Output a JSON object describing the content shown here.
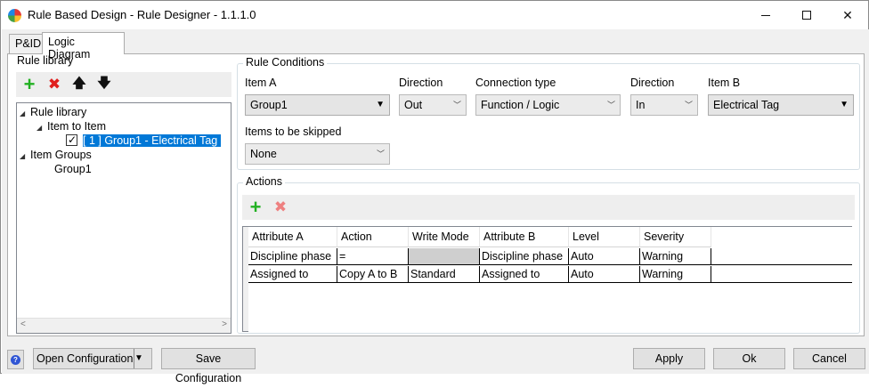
{
  "window": {
    "title": "Rule Based Design - Rule Designer - 1.1.1.0",
    "minimize_glyph": "—",
    "close_glyph": "✕"
  },
  "tabs": [
    {
      "label": "P&ID"
    },
    {
      "label": "Logic Diagram"
    }
  ],
  "rule_library": {
    "title": "Rule library",
    "tree": {
      "root": "Rule library",
      "item_to_item": "Item to Item",
      "rule_entry": "[ 1 ]   Group1 - Electrical Tag",
      "item_groups": "Item Groups",
      "group1": "Group1"
    }
  },
  "rule_conditions": {
    "title": "Rule Conditions",
    "item_a": {
      "label": "Item A",
      "value": "Group1"
    },
    "direction_a": {
      "label": "Direction",
      "value": "Out"
    },
    "connection_type": {
      "label": "Connection type",
      "value": "Function / Logic"
    },
    "direction_b": {
      "label": "Direction",
      "value": "In"
    },
    "item_b": {
      "label": "Item B",
      "value": "Electrical Tag"
    },
    "items_skipped": {
      "label": "Items to be skipped",
      "value": "None"
    }
  },
  "actions": {
    "title": "Actions",
    "columns": [
      "Attribute A",
      "Action",
      "Write Mode",
      "Attribute B",
      "Level",
      "Severity"
    ],
    "rows": [
      [
        "Discipline phase",
        "=",
        "",
        "Discipline phase",
        "Auto",
        "Warning"
      ],
      [
        "Assigned to",
        "Copy A to B",
        "Standard",
        "Assigned to",
        "Auto",
        "Warning"
      ]
    ]
  },
  "footer": {
    "help_glyph": "?",
    "open_config": "Open Configuration",
    "save_config": "Save Configuration",
    "apply": "Apply",
    "ok": "Ok",
    "cancel": "Cancel"
  }
}
